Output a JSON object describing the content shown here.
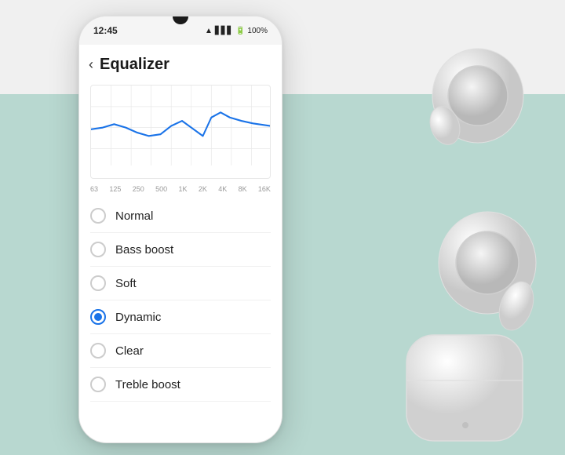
{
  "background": {
    "top_color": "#f0f0f0",
    "bottom_color": "#b8d8d0"
  },
  "phone": {
    "time": "12:45",
    "battery": "100%",
    "signal": "WiFi + LTE"
  },
  "app": {
    "title": "Equalizer",
    "back_label": "‹"
  },
  "chart": {
    "freq_labels": [
      "63",
      "125",
      "250",
      "500",
      "1K",
      "2K",
      "4K",
      "8K",
      "16K"
    ]
  },
  "options": [
    {
      "label": "Normal",
      "selected": false
    },
    {
      "label": "Bass boost",
      "selected": false
    },
    {
      "label": "Soft",
      "selected": false
    },
    {
      "label": "Dynamic",
      "selected": true
    },
    {
      "label": "Clear",
      "selected": false
    },
    {
      "label": "Treble boost",
      "selected": false
    }
  ]
}
